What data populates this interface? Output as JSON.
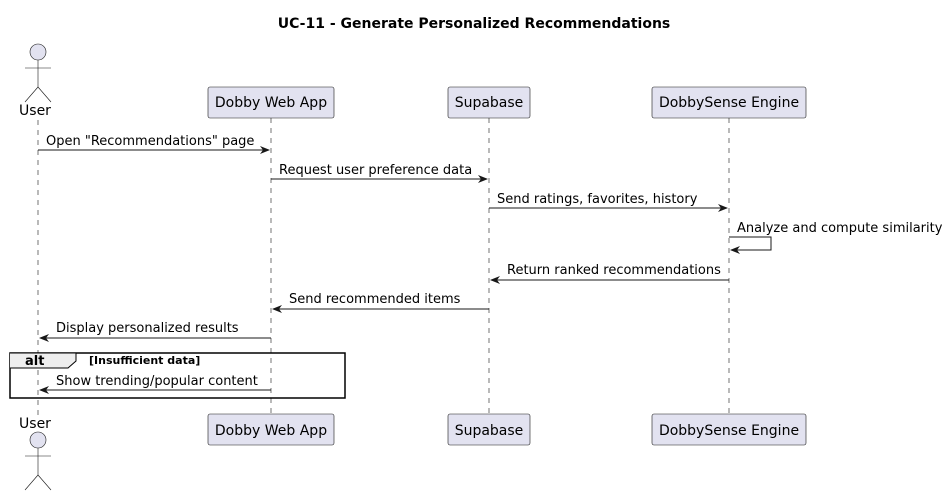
{
  "title": "UC-11 - Generate Personalized Recommendations",
  "colors": {
    "participant_fill": "#E2E2F0",
    "participant_stroke": "#181818",
    "lifeline": "#181818",
    "arrow": "#181818"
  },
  "participants": [
    {
      "id": "user",
      "label": "User",
      "kind": "actor"
    },
    {
      "id": "webapp",
      "label": "Dobby Web App",
      "kind": "participant"
    },
    {
      "id": "supabase",
      "label": "Supabase",
      "kind": "participant"
    },
    {
      "id": "engine",
      "label": "DobbySense Engine",
      "kind": "participant"
    }
  ],
  "messages": [
    {
      "from": "user",
      "to": "webapp",
      "text": "Open \"Recommendations\" page"
    },
    {
      "from": "webapp",
      "to": "supabase",
      "text": "Request user preference data"
    },
    {
      "from": "supabase",
      "to": "engine",
      "text": "Send ratings, favorites, history"
    },
    {
      "from": "engine",
      "to": "engine",
      "text": "Analyze and compute similarity"
    },
    {
      "from": "engine",
      "to": "supabase",
      "text": "Return ranked recommendations"
    },
    {
      "from": "supabase",
      "to": "webapp",
      "text": "Send recommended items"
    },
    {
      "from": "webapp",
      "to": "user",
      "text": "Display personalized results"
    }
  ],
  "alt": {
    "keyword": "alt",
    "guard": "[Insufficient data]",
    "messages": [
      {
        "from": "webapp",
        "to": "user",
        "text": "Show trending/popular content"
      }
    ]
  }
}
